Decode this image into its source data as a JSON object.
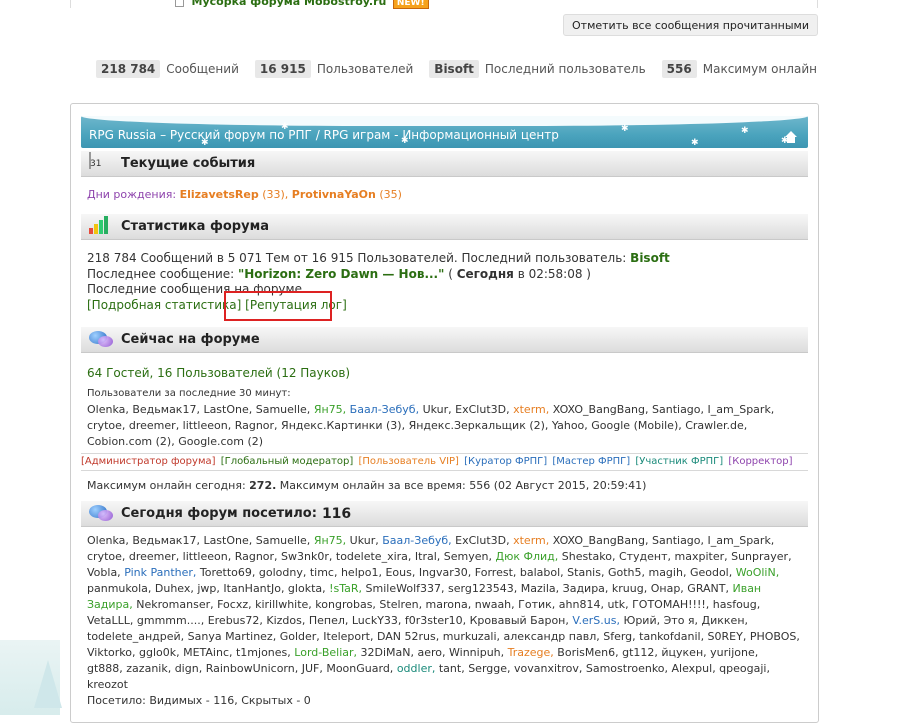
{
  "top": {
    "forum_title": "Мусорка форума Mobostroy.ru",
    "new_badge": "NEW!"
  },
  "mark_read_button": "Отметить все сообщения прочитанными",
  "stats": [
    {
      "num": "218 784",
      "label": "Сообщений"
    },
    {
      "num": "16 915",
      "label": "Пользователей"
    },
    {
      "num": "Bisoft",
      "label": "Последний пользователь"
    },
    {
      "num": "556",
      "label": "Максимум онлайн"
    }
  ],
  "banner_title": "RPG Russia – Русский форум по РПГ / RPG играм - Информационный центр",
  "events": {
    "heading": "Текущие события",
    "calendar_day": "31",
    "birthdays_label": "Дни рождения:",
    "b1_name": "ElizavetsRep",
    "b1_age": "(33),",
    "b2_name": "ProtivnaYaOn",
    "b2_age": "(35)"
  },
  "forum_stats": {
    "heading": "Статистика форума",
    "line1_prefix": "218 784 Сообщений в 5 071 Тем от 16 915 Пользователей. Последний пользователь:",
    "line1_user": "Bisoft",
    "line2_prefix": "Последнее сообщение:",
    "line2_topic": "\"Horizon: Zero Dawn — Нов...\"",
    "line2_open": "(",
    "line2_when": "Сегодня",
    "line2_time": "в 02:58:08 )",
    "line3": "Последние сообщения на форуме.",
    "link_detailed": "[Подробная статистика]",
    "link_rep": "[Репутация лог]"
  },
  "online": {
    "heading": "Сейчас на форуме",
    "summary": "64 Гостей, 16 Пользователей (12 Пауков)",
    "users_label": "Пользователи за последние 30 минут:",
    "line1_a": "Olenka, Ведьмак17, LastOne, Samuelle,",
    "line1_b": "Ян75,",
    "line1_c": "Баал-Зебуб,",
    "line1_d": "Ukur, ExClut3D,",
    "line1_e": "xterm,",
    "line1_f": "XOXO_BangBang, Santiago, I_am_Spark,",
    "line2": "crytoe, dreemer, littleeon, Ragnor, Яндекс.Картинки (3), Яндекс.Зеркальщик (2), Yahoo, Google (Mobile), Crawler.de,",
    "line3": "Cobion.com (2), Google.com (2)"
  },
  "legend": [
    {
      "text": "[Администратор форума]",
      "color": "#c0392b"
    },
    {
      "text": "[Глобальный модератор]",
      "color": "#2b6e12"
    },
    {
      "text": "[Пользователь VIP]",
      "color": "#e67e22"
    },
    {
      "text": "[Куратор ФРПГ]",
      "color": "#2a6ebb"
    },
    {
      "text": "[Мастер ФРПГ]",
      "color": "#2a6ebb"
    },
    {
      "text": "[Участник ФРПГ]",
      "color": "#1a8a7a"
    },
    {
      "text": "[Корректор]",
      "color": "#8e44ad"
    }
  ],
  "max_online": {
    "prefix": "Максимум онлайн сегодня:",
    "today": "272.",
    "rest": "Максимум онлайн за все время: 556 (02 Август 2015, 20:59:41)"
  },
  "visited": {
    "heading": "Сегодня форум посетило:",
    "count": "116",
    "l1_a": "Olenka, Ведьмак17, LastOne, Samuelle,",
    "l1_b": "Ян75,",
    "l1_c": "Ukur,",
    "l1_d": "Баал-Зебуб,",
    "l1_e": "ExClut3D,",
    "l1_f": "xterm,",
    "l1_g": "XOXO_BangBang, Santiago, I_am_Spark,",
    "l2_a": "crytoe, dreemer, littleeon, Ragnor, Sw3nk0r, todelete_xira, Itral, Semyen,",
    "l2_b": "Дюк Флид,",
    "l2_c": "Shestako, Студент, maxpiter, Sunprayer,",
    "l3_a": "Vobla,",
    "l3_b": "Pink Panther,",
    "l3_c": "Toretto69, golodny, timc, helpo1, Eous, Ingvar30, Forrest, balabol, Stanis, Goth5, magih, Geodol,",
    "l3_d": "WoOliN,",
    "l4_a": "panmukola, Duhex, jwp, ItanHantJo, glokta,",
    "l4_b": "!sTaR,",
    "l4_c": "SmileWolf337, serg123543, Mazila, Задира, kruug, Онар, GRANT,",
    "l4_d": "Иван",
    "l5_a": "Задира,",
    "l5_b": "Nekromanser, Focxz, kirillwhite, kongrobas, Stelren, marona, nwaah, Готик, ahn814, utk, ГОТОМАН!!!!, hasfoug,",
    "l6": "VetaLLL, gmmmm...., Erebus72, Kizdos, Пепел, LuckY33, f0r3ster10, Кровавый Барон,",
    "l6_b": "V.erS.us,",
    "l6_c": "Юрий, Это я, Диккен,",
    "l7": "todelete_андрей, Sanya Martinez, Golder, Iteleport, DAN 52rus, murkuzali, александр павл, Sferg, tankofdanil, S0REY, PHOBOS,",
    "l8_a": "Viktorko, gglo0k, METAinc, t1mjones,",
    "l8_b": "Lord-Beliar,",
    "l8_c": "32DiMaN, aero, Winnipuh,",
    "l8_d": "Trazege,",
    "l8_e": "BorisMen6, gt112, йцукен, yurijone,",
    "l9_a": "gt888, zazanik, dign, RainbowUnicorn, JUF, MoonGuard,",
    "l9_b": "oddler,",
    "l9_c": "tant, Sergge, vovanxitrov, Samostroenko, Alexpul, qpeogaji,",
    "l10": "kreozot",
    "footer": "Посетило: Видимых - 116, Скрытых - 0"
  }
}
